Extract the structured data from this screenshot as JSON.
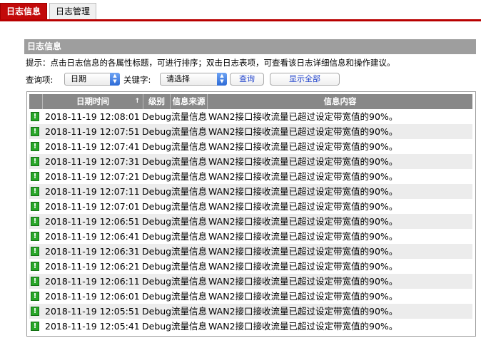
{
  "tabs": [
    {
      "label": "日志信息",
      "active": true
    },
    {
      "label": "日志管理",
      "active": false
    }
  ],
  "section_title": "日志信息",
  "hint": "提示：点击日志信息的各属性标题，可进行排序；双击日志表项，可查看该日志详细信息和操作建议。",
  "query": {
    "item_label": "查询项:",
    "item_value": "日期",
    "keyword_label": "关键字:",
    "keyword_value": "请选择",
    "search_button": "查询",
    "show_all_button": "显示全部"
  },
  "table": {
    "headers": [
      "",
      "日期时间",
      "级别",
      "信息来源",
      "信息内容"
    ],
    "sort_indicator": "↑",
    "rows": [
      {
        "datetime": "2018-11-19 12:08:01",
        "level": "Debug",
        "source": "流量信息",
        "content": "WAN2接口接收流量已超过设定带宽值的90%。"
      },
      {
        "datetime": "2018-11-19 12:07:51",
        "level": "Debug",
        "source": "流量信息",
        "content": "WAN2接口接收流量已超过设定带宽值的90%。"
      },
      {
        "datetime": "2018-11-19 12:07:41",
        "level": "Debug",
        "source": "流量信息",
        "content": "WAN2接口接收流量已超过设定带宽值的90%。"
      },
      {
        "datetime": "2018-11-19 12:07:31",
        "level": "Debug",
        "source": "流量信息",
        "content": "WAN2接口接收流量已超过设定带宽值的90%。"
      },
      {
        "datetime": "2018-11-19 12:07:21",
        "level": "Debug",
        "source": "流量信息",
        "content": "WAN2接口接收流量已超过设定带宽值的90%。"
      },
      {
        "datetime": "2018-11-19 12:07:11",
        "level": "Debug",
        "source": "流量信息",
        "content": "WAN2接口接收流量已超过设定带宽值的90%。"
      },
      {
        "datetime": "2018-11-19 12:07:01",
        "level": "Debug",
        "source": "流量信息",
        "content": "WAN2接口接收流量已超过设定带宽值的90%。"
      },
      {
        "datetime": "2018-11-19 12:06:51",
        "level": "Debug",
        "source": "流量信息",
        "content": "WAN2接口接收流量已超过设定带宽值的90%。"
      },
      {
        "datetime": "2018-11-19 12:06:41",
        "level": "Debug",
        "source": "流量信息",
        "content": "WAN2接口接收流量已超过设定带宽值的90%。"
      },
      {
        "datetime": "2018-11-19 12:06:31",
        "level": "Debug",
        "source": "流量信息",
        "content": "WAN2接口接收流量已超过设定带宽值的90%。"
      },
      {
        "datetime": "2018-11-19 12:06:21",
        "level": "Debug",
        "source": "流量信息",
        "content": "WAN2接口接收流量已超过设定带宽值的90%。"
      },
      {
        "datetime": "2018-11-19 12:06:11",
        "level": "Debug",
        "source": "流量信息",
        "content": "WAN2接口接收流量已超过设定带宽值的90%。"
      },
      {
        "datetime": "2018-11-19 12:06:01",
        "level": "Debug",
        "source": "流量信息",
        "content": "WAN2接口接收流量已超过设定带宽值的90%。"
      },
      {
        "datetime": "2018-11-19 12:05:51",
        "level": "Debug",
        "source": "流量信息",
        "content": "WAN2接口接收流量已超过设定带宽值的90%。"
      },
      {
        "datetime": "2018-11-19 12:05:41",
        "level": "Debug",
        "source": "流量信息",
        "content": "WAN2接口接收流量已超过设定带宽值的90%。"
      }
    ]
  },
  "icons": {
    "row_status": "exclamation-icon",
    "row_status_glyph": "!"
  },
  "colors": {
    "tab_active": "#c20a0a",
    "header_bg": "#888888",
    "section_bg": "#9e9e9e",
    "debug_icon": "#29a629"
  }
}
